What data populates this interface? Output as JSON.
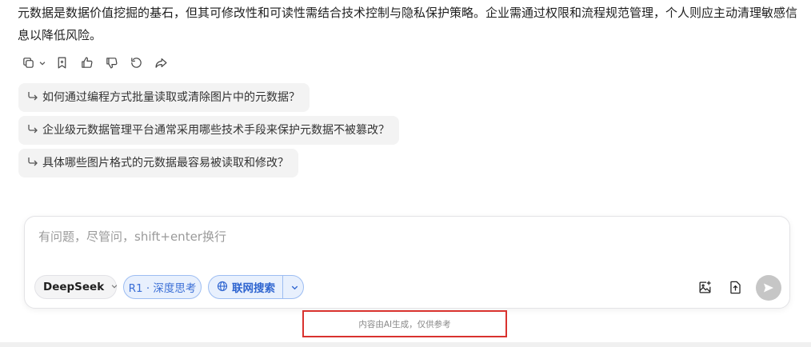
{
  "answer": {
    "text": "元数据是数据价值挖掘的基石，但其可修改性和可读性需结合技术控制与隐私保护策略。企业需通过权限和流程规范管理，个人则应主动清理敏感信息以降低风险。"
  },
  "actions": {
    "copy": "copy-icon",
    "bookmark": "bookmark-icon",
    "like": "thumbs-up-icon",
    "dislike": "thumbs-down-icon",
    "regenerate": "refresh-icon",
    "share": "share-icon"
  },
  "suggestions": [
    "如何通过编程方式批量读取或清除图片中的元数据？",
    "企业级元数据管理平台通常采用哪些技术手段来保护元数据不被篡改？",
    "具体哪些图片格式的元数据最容易被读取和修改？"
  ],
  "composer": {
    "placeholder": "有问题，尽管问，shift+enter换行",
    "model_label": "DeepSeek",
    "r1_label": "R1 · 深度思考",
    "web_search_label": "联网搜索"
  },
  "colors": {
    "accent": "#3b6fd6",
    "chip_bg": "#e8f0fd",
    "send_disabled": "#c6c6c6",
    "highlight_border": "#d9322e"
  },
  "footer": {
    "disclaimer": "内容由AI生成，仅供参考"
  }
}
